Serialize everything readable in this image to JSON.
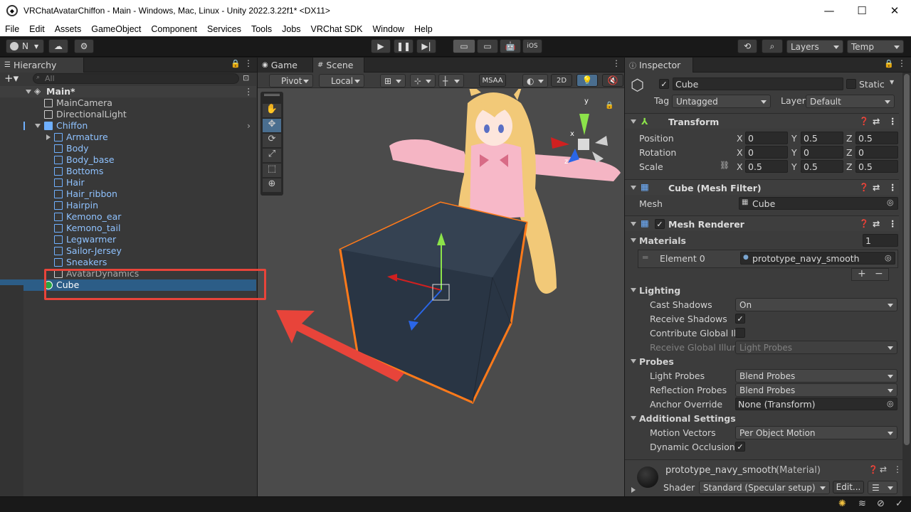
{
  "window": {
    "title": "VRChatAvatarChiffon - Main - Windows, Mac, Linux - Unity 2022.3.22f1* <DX11>",
    "minimize": "—",
    "maximize": "☐",
    "close": "✕"
  },
  "menu": [
    "File",
    "Edit",
    "Assets",
    "GameObject",
    "Component",
    "Services",
    "Tools",
    "Jobs",
    "VRChat SDK",
    "Window",
    "Help"
  ],
  "toolbar": {
    "account": "N",
    "layers": "Layers",
    "layout": "Temp",
    "ios": "iOS"
  },
  "hierarchy": {
    "tab": "Hierarchy",
    "search_placeholder": "All",
    "scene": "Main*",
    "items": [
      {
        "label": "MainCamera",
        "depth": 1,
        "color": "white"
      },
      {
        "label": "DirectionalLight",
        "depth": 1,
        "color": "white"
      },
      {
        "label": "Chiffon",
        "depth": 1,
        "color": "blue"
      },
      {
        "label": "Armature",
        "depth": 2,
        "color": "blue"
      },
      {
        "label": "Body",
        "depth": 2,
        "color": "blue"
      },
      {
        "label": "Body_base",
        "depth": 2,
        "color": "blue"
      },
      {
        "label": "Bottoms",
        "depth": 2,
        "color": "blue"
      },
      {
        "label": "Hair",
        "depth": 2,
        "color": "blue"
      },
      {
        "label": "Hair_ribbon",
        "depth": 2,
        "color": "blue"
      },
      {
        "label": "Hairpin",
        "depth": 2,
        "color": "blue"
      },
      {
        "label": "Kemono_ear",
        "depth": 2,
        "color": "blue"
      },
      {
        "label": "Kemono_tail",
        "depth": 2,
        "color": "blue"
      },
      {
        "label": "Legwarmer",
        "depth": 2,
        "color": "blue"
      },
      {
        "label": "Sailor-Jersey",
        "depth": 2,
        "color": "blue"
      },
      {
        "label": "Sneakers",
        "depth": 2,
        "color": "blue"
      },
      {
        "label": "AvatarDynamics",
        "depth": 2,
        "color": "white"
      },
      {
        "label": "Cube",
        "depth": 1,
        "color": "white",
        "selected": true
      }
    ]
  },
  "scene_view": {
    "tab_game": "Game",
    "tab_scene": "Scene",
    "pivot": "Pivot",
    "local": "Local",
    "msaa": "MSAA",
    "mode_2d": "2D",
    "gizmo_y": "y",
    "gizmo_z": "z",
    "gizmo_x": "x"
  },
  "inspector": {
    "tab": "Inspector",
    "name": "Cube",
    "static": "Static",
    "tag_label": "Tag",
    "tag": "Untagged",
    "layer_label": "Layer",
    "layer": "Default",
    "transform": {
      "title": "Transform",
      "position_label": "Position",
      "rotation_label": "Rotation",
      "scale_label": "Scale",
      "position": {
        "x": "0",
        "y": "0.5",
        "z": "0.5"
      },
      "rotation": {
        "x": "0",
        "y": "0",
        "z": "0"
      },
      "scale": {
        "x": "0.5",
        "y": "0.5",
        "z": "0.5"
      }
    },
    "mesh_filter": {
      "title": "Cube (Mesh Filter)",
      "mesh_label": "Mesh",
      "mesh": "Cube"
    },
    "mesh_renderer": {
      "title": "Mesh Renderer",
      "materials_label": "Materials",
      "materials_count": "1",
      "element_label": "Element 0",
      "element_value": "prototype_navy_smooth",
      "lighting": "Lighting",
      "cast_shadows_label": "Cast Shadows",
      "cast_shadows": "On",
      "receive_shadows_label": "Receive Shadows",
      "contribute_gi_label": "Contribute Global Illu",
      "receive_gi_label": "Receive Global Illumi",
      "receive_gi": "Light Probes",
      "probes": "Probes",
      "light_probes_label": "Light Probes",
      "light_probes": "Blend Probes",
      "reflection_probes_label": "Reflection Probes",
      "reflection_probes": "Blend Probes",
      "anchor_override_label": "Anchor Override",
      "anchor_override": "None (Transform)",
      "additional": "Additional Settings",
      "motion_vectors_label": "Motion Vectors",
      "motion_vectors": "Per Object Motion",
      "dynamic_occlusion_label": "Dynamic Occlusion"
    },
    "material": {
      "name": "prototype_navy_smooth",
      "type": "(Material)",
      "shader_label": "Shader",
      "shader": "Standard (Specular setup)",
      "edit": "Edit..."
    }
  },
  "colors": {
    "accent": "#2c5d87",
    "highlight_red": "#e8443a",
    "selection_orange": "#ff7a1a"
  }
}
